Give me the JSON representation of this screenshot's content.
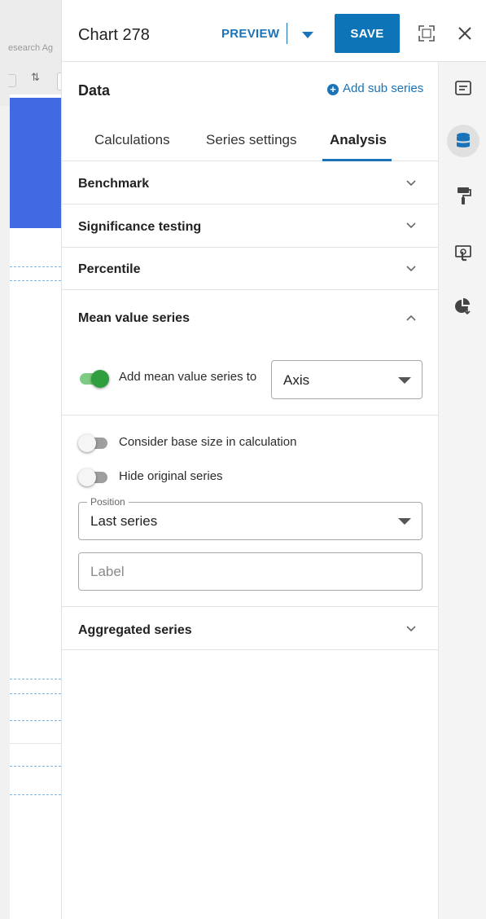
{
  "background": {
    "breadcrumb_fragment": "esearch Ag"
  },
  "header": {
    "title": "Chart 278",
    "preview_label": "PREVIEW",
    "save_label": "SAVE"
  },
  "data_section": {
    "title": "Data",
    "add_sub_series_label": "Add sub series",
    "tabs": [
      {
        "label": "Calculations",
        "active": false
      },
      {
        "label": "Series settings",
        "active": false
      },
      {
        "label": "Analysis",
        "active": true
      }
    ]
  },
  "sections": {
    "benchmark": {
      "label": "Benchmark",
      "expanded": false
    },
    "significance": {
      "label": "Significance testing",
      "expanded": false
    },
    "percentile": {
      "label": "Percentile",
      "expanded": false
    },
    "mean_value": {
      "label": "Mean value series",
      "expanded": true,
      "add_mean_toggle": {
        "label": "Add mean value series to",
        "on": true
      },
      "add_mean_select": {
        "value": "Axis"
      },
      "base_size_toggle": {
        "label": "Consider base size in calculation",
        "on": false
      },
      "hide_original_toggle": {
        "label": "Hide original series",
        "on": false
      },
      "position_select": {
        "legend": "Position",
        "value": "Last series"
      },
      "label_input": {
        "placeholder": "Label",
        "value": ""
      }
    },
    "aggregated": {
      "label": "Aggregated series",
      "expanded": false
    }
  },
  "rail_icons": [
    "text-panel-icon",
    "database-icon",
    "paint-roller-icon",
    "touch-screen-icon",
    "pie-export-icon"
  ],
  "colors": {
    "accent": "#1a73b8",
    "save_bg": "#0d74b8",
    "toggle_on": "#2e9e3e",
    "bg_bar": "#4169e1"
  }
}
